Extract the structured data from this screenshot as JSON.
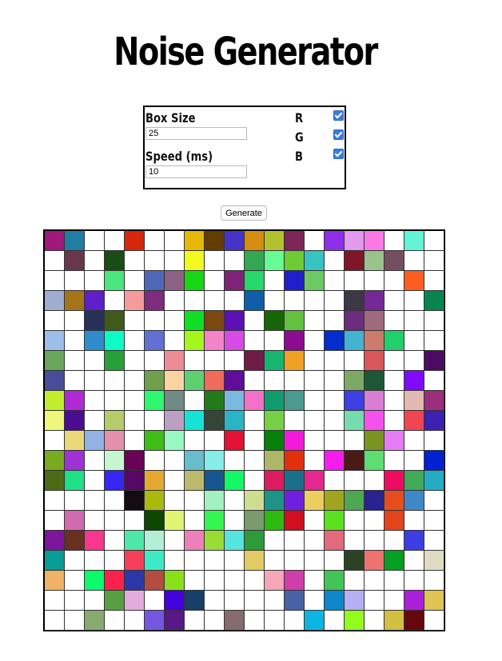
{
  "title": "Noise Generator",
  "controls": {
    "box_size_label": "Box Size",
    "box_size_value": "25",
    "speed_label": "Speed (ms)",
    "speed_value": "10",
    "r_label": "R",
    "g_label": "G",
    "b_label": "B",
    "r_checked": true,
    "g_checked": true,
    "b_checked": true
  },
  "generate_label": "Generate",
  "grid": {
    "colors": [
      [
        "#a0197a",
        "#217da3",
        "#ffffff",
        "#ffffff",
        "#d5270c",
        "#ffffff",
        "#ffffff",
        "#e7b708",
        "#633d02",
        "#4634c9",
        "#d48e11",
        "#b3c12e",
        "#7d2458",
        "#ffffff",
        "#8e2ee8",
        "#e09aee",
        "#f97ae6",
        "#ffffff",
        "#63f4d6",
        "#ffffff"
      ],
      [
        "#ffffff",
        "#68374a",
        "#ffffff",
        "#1a4d14",
        "#ffffff",
        "#ffffff",
        "#ffffff",
        "#f2f91f",
        "#ffffff",
        "#ffffff",
        "#33a854",
        "#66fc93",
        "#6dcb34",
        "#36c3c1",
        "#ffffff",
        "#801728",
        "#99c38d",
        "#754f60",
        "#ffffff",
        "#ffffff"
      ],
      [
        "#ffffff",
        "#ffffff",
        "#ffffff",
        "#4be57d",
        "#ffffff",
        "#5066b9",
        "#8d6183",
        "#17d615",
        "#ffffff",
        "#7d2478",
        "#26d76a",
        "#ffffff",
        "#2020cb",
        "#6dc964",
        "#ffffff",
        "#ffffff",
        "#ffffff",
        "#ffffff",
        "#fd5d20",
        "#ffffff"
      ],
      [
        "#9fadd1",
        "#a77519",
        "#5e1ec9",
        "#ffffff",
        "#f49b9c",
        "#7f2b7e",
        "#ffffff",
        "#ffffff",
        "#ffffff",
        "#ffffff",
        "#105ea9",
        "#ffffff",
        "#ffffff",
        "#ffffff",
        "#ffffff",
        "#3c3845",
        "#752896",
        "#ffffff",
        "#ffffff",
        "#07854f"
      ],
      [
        "#ffffff",
        "#ffffff",
        "#26315a",
        "#405a1d",
        "#ffffff",
        "#ffffff",
        "#ffffff",
        "#0fde24",
        "#7c4912",
        "#5c10b5",
        "#ffffff",
        "#166607",
        "#63c13f",
        "#ffffff",
        "#ffffff",
        "#6b2d7c",
        "#a06a7d",
        "#ffffff",
        "#ffffff",
        "#ffffff"
      ],
      [
        "#9dbee9",
        "#ffffff",
        "#2f8ccc",
        "#0cfcc6",
        "#ffffff",
        "#6171d1",
        "#ffffff",
        "#a5f51e",
        "#f483c8",
        "#d74be3",
        "#ffffff",
        "#ffffff",
        "#8b0c91",
        "#ffffff",
        "#052ccc",
        "#42b3d3",
        "#cd7b6d",
        "#20d06a",
        "#ffffff",
        "#ffffff"
      ],
      [
        "#6aa65c",
        "#ffffff",
        "#ffffff",
        "#28a039",
        "#ffffff",
        "#ffffff",
        "#ed8c95",
        "#ffffff",
        "#ffffff",
        "#ffffff",
        "#711b47",
        "#18b471",
        "#efa124",
        "#ffffff",
        "#ffffff",
        "#ffffff",
        "#da5759",
        "#ffffff",
        "#ffffff",
        "#4e0b63"
      ],
      [
        "#474d96",
        "#ffffff",
        "#ffffff",
        "#ffffff",
        "#ffffff",
        "#6f9e4c",
        "#fdd3a3",
        "#5dd16f",
        "#ef6b5a",
        "#610c9a",
        "#ffffff",
        "#ffffff",
        "#ffffff",
        "#ffffff",
        "#ffffff",
        "#7da966",
        "#1e5735",
        "#ffffff",
        "#800bf9",
        "#ffffff"
      ],
      [
        "#c0ee2d",
        "#b02ad4",
        "#ffffff",
        "#ffffff",
        "#ffffff",
        "#2df76d",
        "#6e8a83",
        "#ffffff",
        "#237a18",
        "#7db8e0",
        "#f371c8",
        "#119c6d",
        "#4c9a8f",
        "#ffffff",
        "#ffffff",
        "#3f40e4",
        "#d87ed5",
        "#ffffff",
        "#e0b9b0",
        "#9b2f7d"
      ],
      [
        "#edf77b",
        "#4a0d92",
        "#ffffff",
        "#b6cb6c",
        "#ffffff",
        "#ffffff",
        "#bba0c4",
        "#16e3d6",
        "#364538",
        "#29b5c5",
        "#ffffff",
        "#76d046",
        "#ffffff",
        "#ffffff",
        "#ffffff",
        "#77dbb0",
        "#f452ed",
        "#ffffff",
        "#f14553",
        "#3e20b2"
      ],
      [
        "#ffffff",
        "#e9d878",
        "#93b1e5",
        "#e58fad",
        "#ffffff",
        "#3fbc16",
        "#98f8c1",
        "#ffffff",
        "#ffffff",
        "#e31234",
        "#ffffff",
        "#05800b",
        "#f41ada",
        "#ffffff",
        "#ffffff",
        "#ffffff",
        "#7b9320",
        "#e77df6",
        "#ffffff",
        "#ffffff"
      ],
      [
        "#78ab1f",
        "#9f32d4",
        "#ffffff",
        "#c6f6d0",
        "#6a0357",
        "#ffffff",
        "#ffffff",
        "#68bccb",
        "#86ede6",
        "#ffffff",
        "#ffffff",
        "#adb765",
        "#e1310c",
        "#ffffff",
        "#f41ded",
        "#4a1a17",
        "#5ddd73",
        "#ffffff",
        "#ffffff",
        "#0421d1"
      ],
      [
        "#4d6a14",
        "#1fe087",
        "#ffffff",
        "#3826f3",
        "#560867",
        "#e6a830",
        "#ffffff",
        "#bcb96f",
        "#17568f",
        "#14f867",
        "#ffffff",
        "#db1c5f",
        "#1b6f8b",
        "#e4288e",
        "#ffffff",
        "#ffffff",
        "#ffffff",
        "#ed0c62",
        "#40a95a",
        "#24acc4"
      ],
      [
        "#ffffff",
        "#ffffff",
        "#ffffff",
        "#ffffff",
        "#150b13",
        "#aab90d",
        "#ffffff",
        "#ffffff",
        "#a3f0c2",
        "#ffffff",
        "#cfdd90",
        "#1e9488",
        "#6f1fde",
        "#edcc60",
        "#9fa61e",
        "#4ea752",
        "#28238f",
        "#e74e1e",
        "#3f88c7",
        "#ffffff"
      ],
      [
        "#ffffff",
        "#d26ab0",
        "#ffffff",
        "#ffffff",
        "#ffffff",
        "#0d4802",
        "#e0f474",
        "#ffffff",
        "#35f551",
        "#ffffff",
        "#7a9a70",
        "#2cba13",
        "#d00f22",
        "#ffffff",
        "#5be01d",
        "#ffffff",
        "#ffffff",
        "#e4441c",
        "#ffffff",
        "#ffffff"
      ],
      [
        "#7d169c",
        "#693021",
        "#f9378d",
        "#ffffff",
        "#4de8a7",
        "#b2efd6",
        "#ffffff",
        "#ed80b9",
        "#99dc35",
        "#55e5e0",
        "#2d9b3c",
        "#ffffff",
        "#ffffff",
        "#ffffff",
        "#e16b7a",
        "#ffffff",
        "#ffffff",
        "#ffffff",
        "#3d3de2",
        "#ffffff"
      ],
      [
        "#079c95",
        "#ffffff",
        "#ffffff",
        "#ffffff",
        "#f44058",
        "#3eeac6",
        "#ffffff",
        "#ffffff",
        "#ffffff",
        "#ffffff",
        "#e2cb65",
        "#ffffff",
        "#ffffff",
        "#ffffff",
        "#ffffff",
        "#2b4324",
        "#ed7370",
        "#079f21",
        "#ffffff",
        "#e0dcc2"
      ],
      [
        "#efb365",
        "#ffffff",
        "#0cfa6b",
        "#f8234c",
        "#2c37aa",
        "#b24d3f",
        "#8be119",
        "#ffffff",
        "#ffffff",
        "#ffffff",
        "#ffffff",
        "#f7a5b9",
        "#ce3fa9",
        "#ffffff",
        "#44c456",
        "#ffffff",
        "#ffffff",
        "#ffffff",
        "#ffffff",
        "#ffffff"
      ],
      [
        "#ffffff",
        "#ffffff",
        "#ffffff",
        "#589f42",
        "#e3addb",
        "#ffffff",
        "#4402dd",
        "#163f69",
        "#ffffff",
        "#ffffff",
        "#ffffff",
        "#ffffff",
        "#4962a4",
        "#ffffff",
        "#0f87ca",
        "#b6b0f3",
        "#ffffff",
        "#ffffff",
        "#aa20d8",
        "#e0c353"
      ],
      [
        "#ffffff",
        "#ffffff",
        "#88aa71",
        "#ffffff",
        "#ffffff",
        "#7456df",
        "#581887",
        "#ffffff",
        "#ffffff",
        "#846c6f",
        "#ffffff",
        "#ffffff",
        "#ffffff",
        "#0db5e2",
        "#ffffff",
        "#93fc1c",
        "#ffffff",
        "#d1bf41",
        "#66070e",
        "#ffffff"
      ]
    ]
  }
}
